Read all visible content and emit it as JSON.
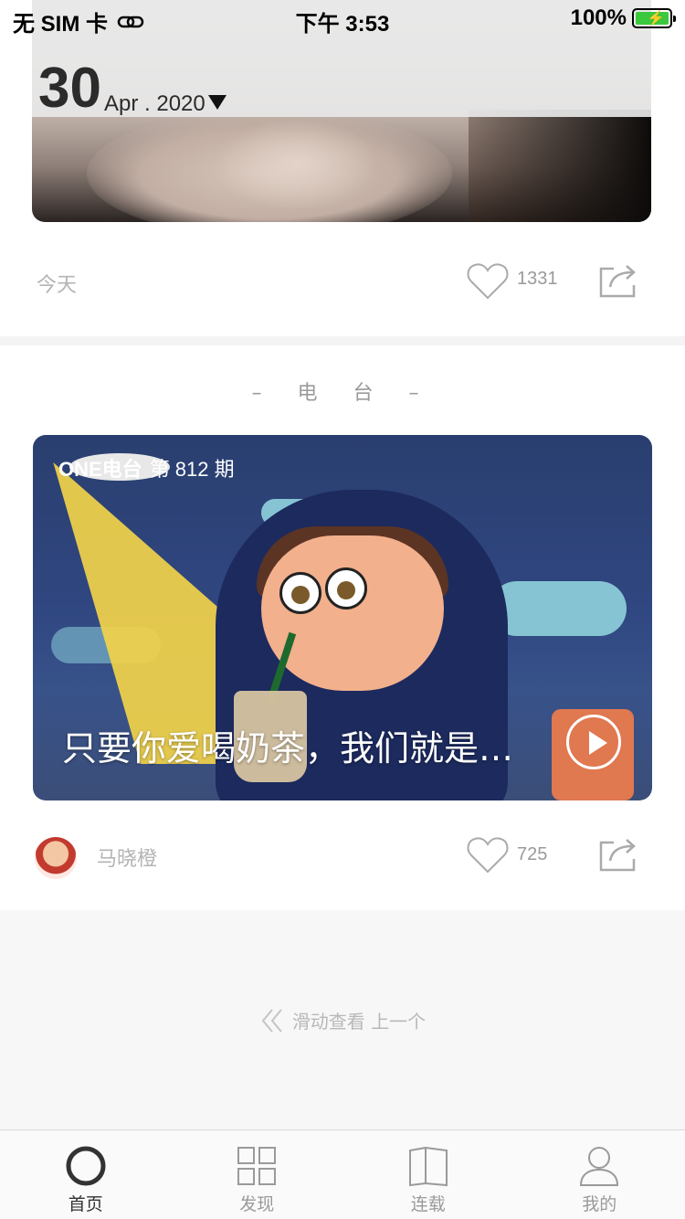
{
  "status_bar": {
    "carrier": "无 SIM 卡",
    "time": "下午 3:53",
    "battery": "100%"
  },
  "top_card": {
    "day": "30",
    "month_year": "Apr . 2020",
    "date_label": "今天",
    "like_count": "1331"
  },
  "radio_section": {
    "title": "– 电 台 –",
    "brand": "ONE电台",
    "issue": "第 812 期",
    "episode_title": "只要你爱喝奶茶，我们就是…",
    "author": "马晓橙",
    "like_count": "725"
  },
  "swipe_hint": "滑动查看 上一个",
  "tabs": [
    {
      "label": "首页",
      "icon": "home-circle-icon",
      "active": true
    },
    {
      "label": "发现",
      "icon": "grid-icon",
      "active": false
    },
    {
      "label": "连载",
      "icon": "book-icon",
      "active": false
    },
    {
      "label": "我的",
      "icon": "person-icon",
      "active": false
    }
  ],
  "colors": {
    "accent_battery": "#3cc83c",
    "muted_text": "#9a9a9a",
    "tab_bar_bg": "#fafafa"
  }
}
